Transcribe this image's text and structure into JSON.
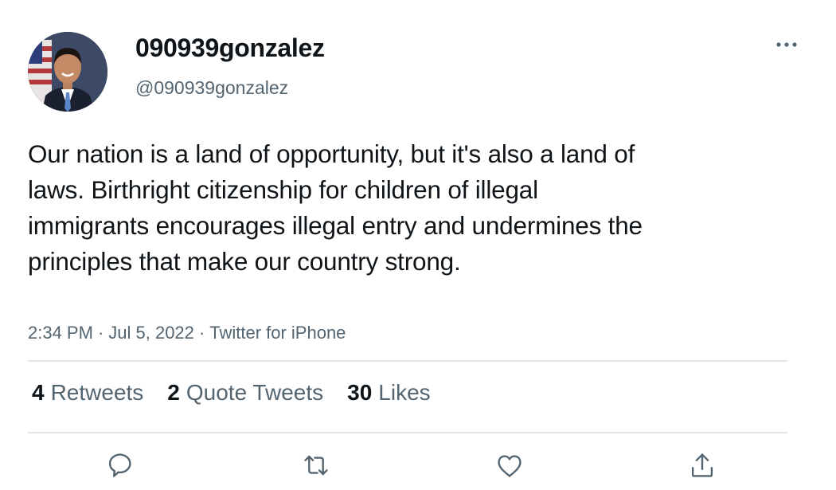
{
  "tweet": {
    "display_name": "090939gonzalez",
    "handle": "@090939gonzalez",
    "text": "Our nation is a land of opportunity, but it's also a land of laws. Birthright citizenship for children of illegal immigrants encourages illegal entry and undermines the principles that make our country strong.",
    "time": "2:34 PM",
    "date": "Jul 5, 2022",
    "source": "Twitter for iPhone",
    "separator": "·"
  },
  "stats": {
    "retweets_count": "4",
    "retweets_label": "Retweets",
    "quote_count": "2",
    "quote_label": "Quote Tweets",
    "likes_count": "30",
    "likes_label": "Likes"
  },
  "actions": {
    "reply_icon": "reply-icon",
    "retweet_icon": "retweet-icon",
    "like_icon": "heart-icon",
    "share_icon": "share-icon",
    "more_icon": "more-icon"
  },
  "colors": {
    "text_primary": "#0f1419",
    "text_secondary": "#536471",
    "icon": "#536471",
    "divider": "#dfe3e6"
  }
}
